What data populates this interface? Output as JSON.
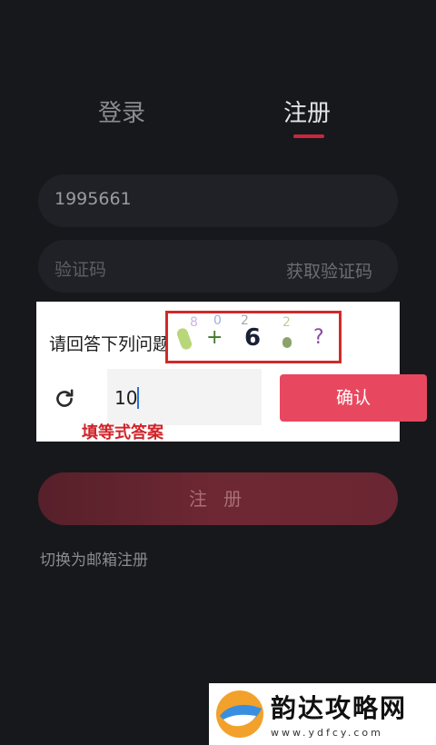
{
  "tabs": {
    "login": "登录",
    "register": "注册"
  },
  "form": {
    "phone_value": "1995661",
    "code_placeholder": "验证码",
    "get_code_label": "获取验证码"
  },
  "captcha_dialog": {
    "question": "请回答下列问题",
    "captcha_symbol": "6",
    "captcha_operator": "+",
    "captcha_unknown": "?",
    "captcha_noise": [
      "0",
      "2",
      "2",
      "8"
    ],
    "answer_value": "10",
    "confirm_label": "确认",
    "annotation": "填等式答案"
  },
  "register_button_label": "注 册",
  "switch_link": "切换为邮箱注册",
  "watermark": {
    "title": "韵达攻略网",
    "url": "www.ydfcy.com"
  },
  "colors": {
    "accent": "#e8485f",
    "tab_underline": "#c9273e",
    "annotation": "#d0242a"
  }
}
